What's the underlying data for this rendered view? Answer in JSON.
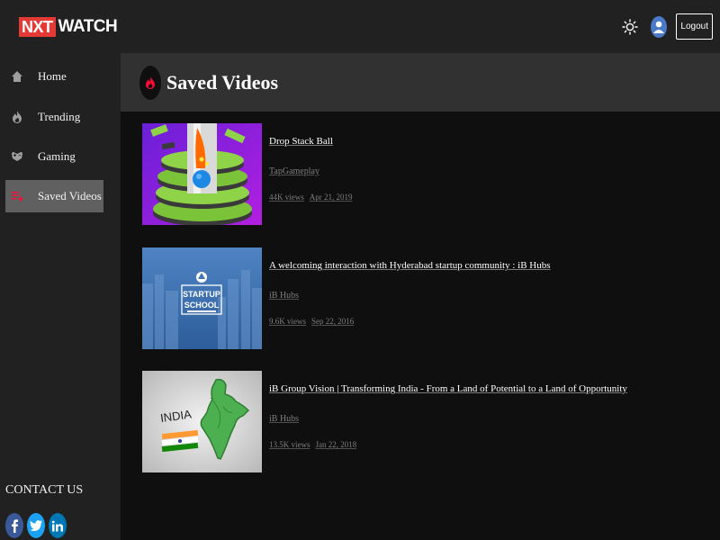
{
  "header": {
    "logo_mark": "NXT",
    "logo_text": "WATCH",
    "theme_icon": "sun-icon",
    "avatar_icon": "user-avatar-icon",
    "logout_label": "Logout"
  },
  "sidebar": {
    "items": [
      {
        "label": "Home",
        "icon": "home-icon",
        "active": false
      },
      {
        "label": "Trending",
        "icon": "fire-icon",
        "active": false
      },
      {
        "label": "Gaming",
        "icon": "gamepad-icon",
        "active": false
      },
      {
        "label": "Saved Videos",
        "icon": "playlist-add-icon",
        "active": true
      }
    ],
    "contact_title": "CONTACT US",
    "socials": [
      "facebook-icon",
      "twitter-icon",
      "linkedin-icon"
    ]
  },
  "banner": {
    "title": "Saved Videos",
    "icon": "fire-icon"
  },
  "videos": [
    {
      "title": "Drop Stack Ball",
      "channel": "TapGameplay",
      "views": "44K views",
      "date": "Apr 21, 2019",
      "thumbnail": "drop-stack-ball-thumbnail"
    },
    {
      "title": "A welcoming interaction with Hyderabad startup community : iB Hubs",
      "channel": "iB Hubs",
      "views": "9.6K views",
      "date": "Sep 22, 2016",
      "thumbnail": "startup-school-thumbnail",
      "thumb_text_1": "STARTUP",
      "thumb_text_2": "SCHOOL"
    },
    {
      "title": "iB Group Vision | Transforming India - From a Land of Potential to a Land of Opportunity",
      "channel": "iB Hubs",
      "views": "13.5K views",
      "date": "Jan 22, 2018",
      "thumbnail": "india-map-thumbnail",
      "thumb_text": "INDIA"
    }
  ],
  "colors": {
    "brand": "#e53935",
    "background": "#0f0f0f",
    "sidebar": "#212121",
    "banner": "#313131",
    "active_item": "#606060",
    "facebook": "#3b5998",
    "twitter": "#1da1f2",
    "linkedin": "#0077b5"
  }
}
